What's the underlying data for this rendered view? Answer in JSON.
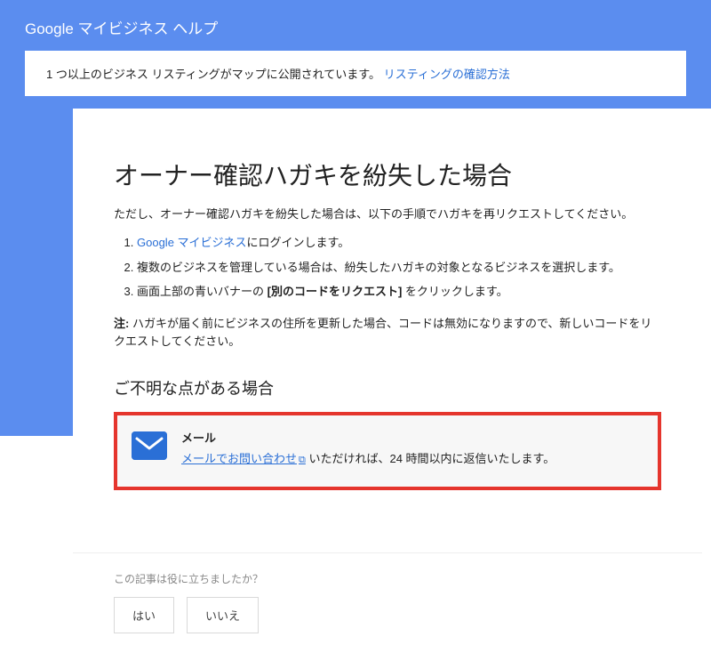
{
  "header": {
    "title": "Google マイビジネス ヘルプ"
  },
  "notice": {
    "text": "1 つ以上のビジネス リスティングがマップに公開されています。",
    "link": "リスティングの確認方法"
  },
  "page": {
    "heading": "オーナー確認ハガキを紛失した場合",
    "lead": "ただし、オーナー確認ハガキを紛失した場合は、以下の手順でハガキを再リクエストしてください。",
    "step1_link": "Google マイビジネス",
    "step1_after": "にログインします。",
    "step2": "複数のビジネスを管理している場合は、紛失したハガキの対象となるビジネスを選択します。",
    "step3_before": "画面上部の青いバナーの ",
    "step3_bold": "[別のコードをリクエスト]",
    "step3_after": " をクリックします。",
    "note_label": "注: ",
    "note_body": "ハガキが届く前にビジネスの住所を更新した場合、コードは無効になりますので、新しいコードをリクエストしてください。",
    "sub_heading": "ご不明な点がある場合"
  },
  "contact": {
    "title": "メール",
    "link": "メールでお問い合わせ",
    "after": " いただければ、24 時間以内に返信いたします。"
  },
  "feedback": {
    "question": "この記事は役に立ちましたか？",
    "yes": "はい",
    "no": "いいえ"
  }
}
